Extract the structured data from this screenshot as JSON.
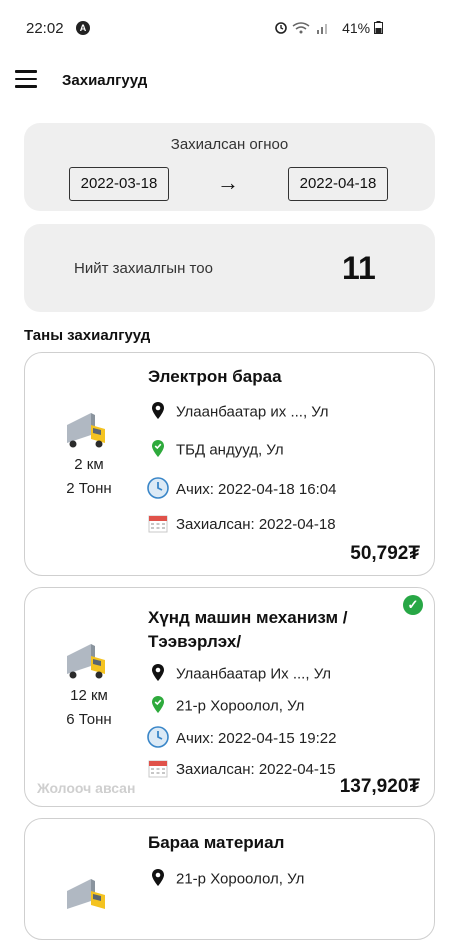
{
  "status_bar": {
    "time": "22:02",
    "a_icon": "A",
    "battery": "41%"
  },
  "app_bar": {
    "title": "Захиалгууд"
  },
  "date_filter": {
    "label": "Захиалсан огноо",
    "from": "2022-03-18",
    "to": "2022-04-18",
    "arrow": "→"
  },
  "summary": {
    "label": "Нийт захиалгын тоо",
    "count": "11"
  },
  "section_title": "Таны захиалгууд",
  "orders": [
    {
      "name": "Электрон бараа",
      "distance": "2 км",
      "weight": "2 Тонн",
      "from": "Улаанбаатар их ..., Ул",
      "to": "ТБД андууд, Ул",
      "departure": "Ачих: 2022-04-18 16:04",
      "ordered": "Захиалсан: 2022-04-18",
      "price": "50,792₮"
    },
    {
      "name": "Хүнд машин механизм / Тээвэрлэх/",
      "distance": "12 км",
      "weight": "6 Тонн",
      "from": "Улаанбаатар Их ..., Ул",
      "to": "21-р Хороолол, Ул",
      "departure": "Ачих: 2022-04-15 19:22",
      "ordered": "Захиалсан: 2022-04-15",
      "price": "137,920₮",
      "status": "Жолооч авсан",
      "check": "✓"
    },
    {
      "name": "Бараа материал",
      "from": "21-р Хороолол, Ул"
    }
  ],
  "colors": {
    "panel": "#efefef",
    "accent_green": "#27a745",
    "clock_blue": "#3a86c8",
    "truck_yellow": "#f4c321"
  },
  "icons": [
    "menu-icon",
    "arrow-right-icon",
    "truck-icon",
    "pin-icon",
    "check-pin-icon",
    "clock-icon",
    "calendar-icon",
    "check-icon"
  ]
}
